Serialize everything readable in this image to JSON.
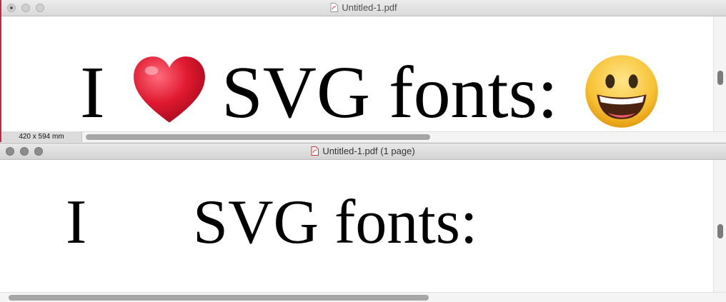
{
  "top_window": {
    "title": "Untitled-1.pdf",
    "text_before": "I",
    "text_after": "SVG fonts:",
    "page_size": "420 x 594 mm",
    "heart_color": "#d8112a",
    "smile_color": "#f7c234",
    "icons": [
      "pdf-document-icon",
      "red-heart-emoji-icon",
      "grinning-face-emoji-icon"
    ]
  },
  "bottom_window": {
    "title": "Untitled-1.pdf (1 page)",
    "text_before": "I",
    "text_after": "SVG fonts:",
    "icons": [
      "pdf-document-icon"
    ]
  }
}
